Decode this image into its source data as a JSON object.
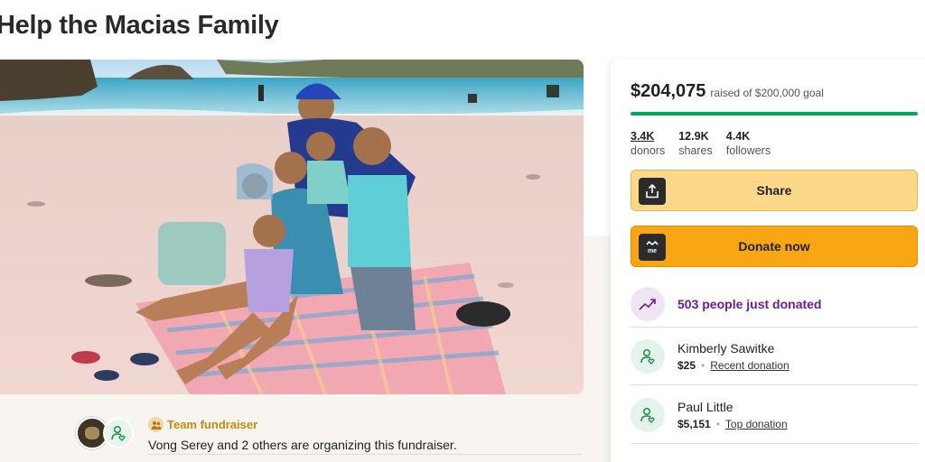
{
  "page": {
    "title": "Help the Macias Family"
  },
  "hero_image": {
    "alt_icon": "family-beach-photo"
  },
  "organizer": {
    "team_label": "Team fundraiser",
    "text": "Vong Serey and 2 others are organizing this fundraiser."
  },
  "panel": {
    "raised": "$204,075",
    "goal_text": "raised of $200,000 goal",
    "progress_fraction": 1.0,
    "stats": [
      {
        "value": "3.4K",
        "label": "donors"
      },
      {
        "value": "12.9K",
        "label": "shares"
      },
      {
        "value": "4.4K",
        "label": "followers"
      }
    ],
    "share_label": "Share",
    "donate_label": "Donate now",
    "just_donated": "503 people just donated",
    "donations": [
      {
        "name": "Kimberly Sawitke",
        "amount": "$25",
        "tag": "Recent donation"
      },
      {
        "name": "Paul Little",
        "amount": "$5,151",
        "tag": "Top donation"
      }
    ]
  },
  "colors": {
    "progress": "#02a95c",
    "share_button": "#fcd98a",
    "donate_button": "#f9a614",
    "accent_purple": "#6a1b9a",
    "team_gold": "#c78a0e"
  }
}
